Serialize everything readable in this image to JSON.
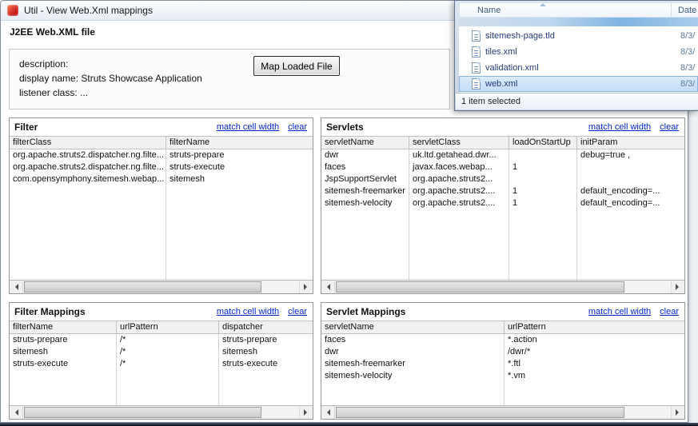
{
  "colors": {
    "link_blue": "#0026c8",
    "selection_fill": "#cfe4f8",
    "selection_border": "#8ab4e0"
  },
  "window": {
    "title": "Util - View Web.Xml mappings"
  },
  "page": {
    "heading": "J2EE Web.XML file"
  },
  "description_box": {
    "line1": "description:",
    "line2": "display name: Struts Showcase Application",
    "line3": "listener class: ...",
    "button_label": "Map Loaded File"
  },
  "links": {
    "match": "match cell width",
    "clear": "clear"
  },
  "panels": {
    "filter": {
      "title": "Filter",
      "columns": [
        "filterClass",
        "filterName"
      ],
      "rows": [
        [
          "org.apache.struts2.dispatcher.ng.filte...",
          "struts-prepare"
        ],
        [
          "org.apache.struts2.dispatcher.ng.filte...",
          "struts-execute"
        ],
        [
          "com.opensymphony.sitemesh.webap...",
          "sitemesh"
        ]
      ]
    },
    "servlets": {
      "title": "Servlets",
      "columns": [
        "servletName",
        "servletClass",
        "loadOnStartUp",
        "initParam"
      ],
      "rows": [
        [
          "dwr",
          "uk.ltd.getahead.dwr...",
          "",
          "debug=true ,"
        ],
        [
          "faces",
          "javax.faces.webap...",
          "1",
          ""
        ],
        [
          "JspSupportServlet",
          "org.apache.struts2...",
          "",
          ""
        ],
        [
          "sitemesh-freemarker",
          "org.apache.struts2....",
          "1",
          "default_encoding=..."
        ],
        [
          "sitemesh-velocity",
          "org.apache.struts2....",
          "1",
          "default_encoding=..."
        ]
      ]
    },
    "filter_mappings": {
      "title": "Filter Mappings",
      "columns": [
        "filterName",
        "urlPattern",
        "dispatcher"
      ],
      "rows": [
        [
          "struts-prepare",
          "/*",
          "struts-prepare"
        ],
        [
          "sitemesh",
          "/*",
          "sitemesh"
        ],
        [
          "struts-execute",
          "/*",
          "struts-execute"
        ]
      ]
    },
    "servlet_mappings": {
      "title": "Servlet Mappings",
      "columns": [
        "servletName",
        "urlPattern"
      ],
      "rows": [
        [
          "faces",
          "*.action"
        ],
        [
          "dwr",
          "/dwr/*"
        ],
        [
          "sitemesh-freemarker",
          "*.ftl"
        ],
        [
          "sitemesh-velocity",
          "*.vm"
        ]
      ]
    }
  },
  "explorer": {
    "columns": {
      "name": "Name",
      "date": "Date"
    },
    "files": [
      {
        "name": "sitemesh-page.tld",
        "date": "8/3/"
      },
      {
        "name": "tiles.xml",
        "date": "8/3/"
      },
      {
        "name": "validation.xml",
        "date": "8/3/"
      },
      {
        "name": "web.xml",
        "date": "8/3/"
      }
    ],
    "status": "1 item selected"
  }
}
